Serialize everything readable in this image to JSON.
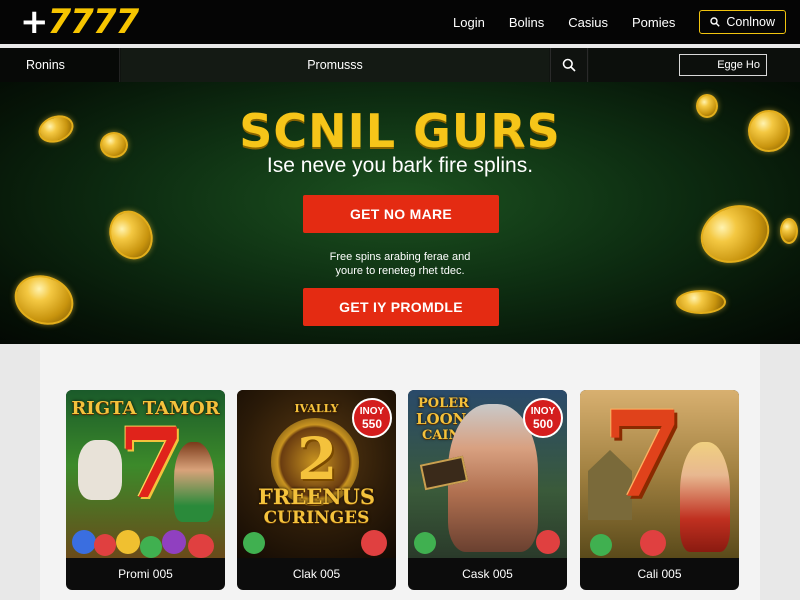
{
  "header": {
    "logo_plus": "+",
    "logo_digits": "7777",
    "nav": [
      "Login",
      "Bolins",
      "Casius",
      "Pomies"
    ],
    "connect_label": "Conlnow"
  },
  "subnav": {
    "left_label": "Ronins",
    "center_label": "Promusss",
    "field_label": "Egge Ho"
  },
  "hero": {
    "title": "SCNIL GURS",
    "subtitle": "Ise neve you bark fire splins.",
    "cta_primary": "GET NO MARE",
    "note_line1": "Free spins arabing ferae and",
    "note_line2": "youre to reneteg rhet tdec.",
    "cta_secondary": "GET IY PROMDLE"
  },
  "games": [
    {
      "title": "RIGTA TAMOR",
      "caption": "Promi 005",
      "badge_top": "",
      "badge_value": ""
    },
    {
      "title": "FREENUS",
      "title2": "CURINGES",
      "top_text": "IVALLY",
      "caption": "Clak 005",
      "badge_top": "INOY",
      "badge_value": "550"
    },
    {
      "title": "POLER",
      "title2": "LOON",
      "title3": "CAIN",
      "caption": "Cask 005",
      "badge_top": "INOY",
      "badge_value": "500"
    },
    {
      "title": "",
      "caption": "Cali 005",
      "badge_top": "",
      "badge_value": ""
    }
  ],
  "colors": {
    "brand_yellow": "#f6c519",
    "cta_red": "#e42b12",
    "hero_green": "#1c5220",
    "header_bg": "#050505"
  },
  "icons": [
    "search-icon",
    "connect-search-icon"
  ]
}
